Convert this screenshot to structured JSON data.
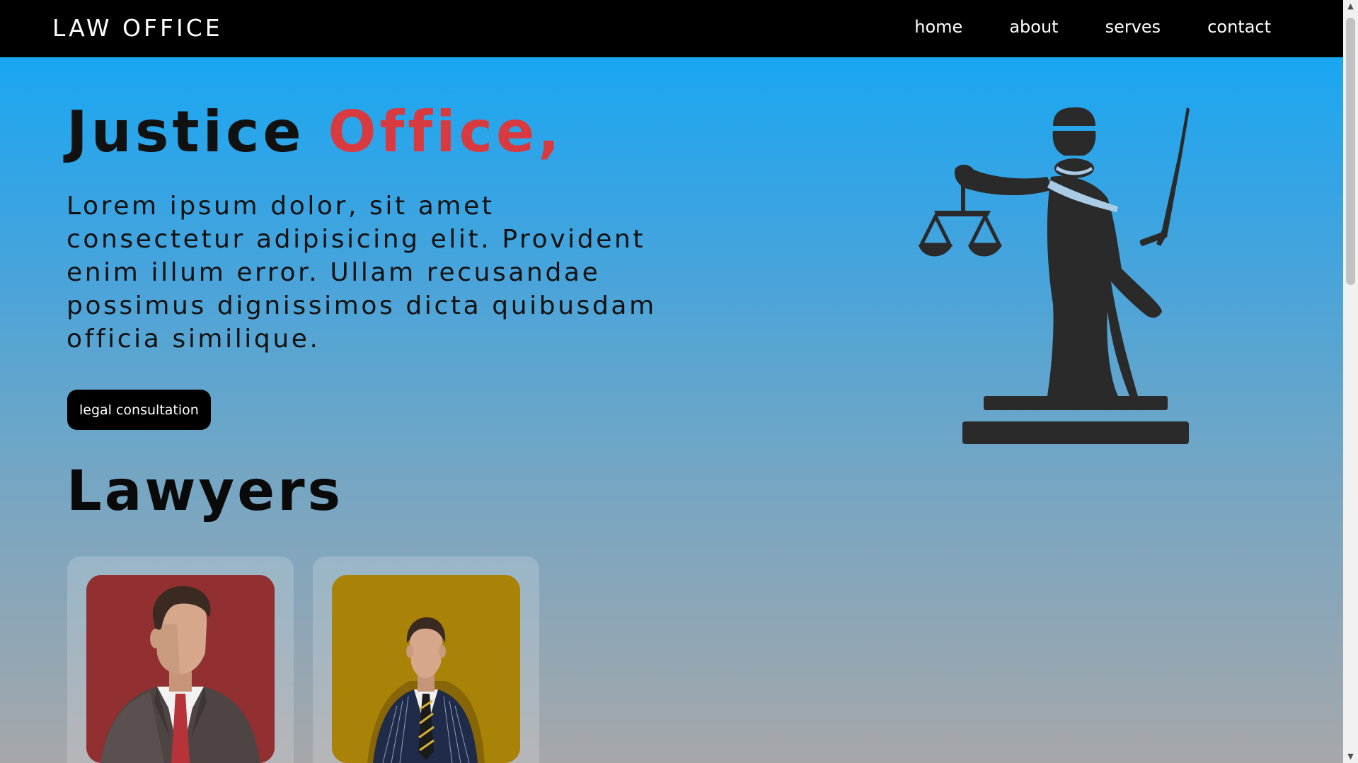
{
  "nav": {
    "logo": "LAW OFFICE",
    "links": [
      "home",
      "about",
      "serves",
      "contact"
    ]
  },
  "hero": {
    "title_part1": "Justice ",
    "title_part2": "Office,",
    "text": "Lorem ipsum dolor, sit amet consectetur adipisicing elit. Provident enim illum error. Ullam recusandae possimus dignissimos dicta quibusdam officia similique.",
    "button": "legal consultation",
    "image_icon": "lady-justice-icon"
  },
  "lawyers": {
    "title": "Lawyers",
    "cards": [
      {
        "portrait": "lawyer-portrait-red",
        "background": "#922f31"
      },
      {
        "portrait": "lawyer-portrait-gold",
        "background": "#a98208"
      }
    ]
  },
  "colors": {
    "accent": "#d93a3f",
    "navbar": "#000000",
    "gradient_top": "#0ea7f8",
    "gradient_bottom": "#a6a7aa"
  },
  "scrollbar": {
    "up_icon": "scroll-up-arrow",
    "down_icon": "scroll-down-arrow"
  }
}
